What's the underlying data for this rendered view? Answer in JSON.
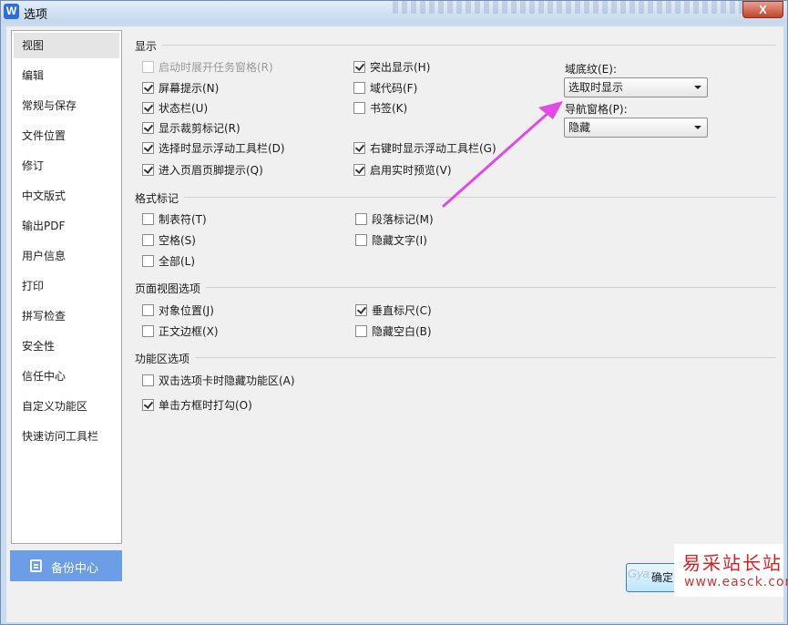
{
  "window": {
    "title": "选项",
    "app_icon_letter": "W",
    "close_label": "X"
  },
  "nav": {
    "items": [
      {
        "label": "视图",
        "active": true
      },
      {
        "label": "编辑"
      },
      {
        "label": "常规与保存"
      },
      {
        "label": "文件位置"
      },
      {
        "label": "修订"
      },
      {
        "label": "中文版式"
      },
      {
        "label": "输出PDF"
      },
      {
        "label": "用户信息"
      },
      {
        "label": "打印"
      },
      {
        "label": "拼写检查"
      },
      {
        "label": "安全性"
      },
      {
        "label": "信任中心"
      },
      {
        "label": "自定义功能区"
      },
      {
        "label": "快速访问工具栏"
      }
    ],
    "backup_label": "备份中心"
  },
  "display": {
    "title": "显示",
    "left": [
      {
        "label": "启动时展开任务窗格(R)",
        "checked": false,
        "disabled": true
      },
      {
        "label": "屏幕提示(N)",
        "checked": true
      },
      {
        "label": "状态栏(U)",
        "checked": true
      },
      {
        "label": "显示裁剪标记(R)",
        "checked": true
      },
      {
        "label": "选择时显示浮动工具栏(D)",
        "checked": true
      },
      {
        "label": "进入页眉页脚提示(Q)",
        "checked": true
      }
    ],
    "right": [
      {
        "label": "突出显示(H)",
        "checked": true
      },
      {
        "label": "域代码(F)",
        "checked": false
      },
      {
        "label": "书签(K)",
        "checked": false
      },
      {
        "label": "右键时显示浮动工具栏(G)",
        "checked": true
      },
      {
        "label": "启用实时预览(V)",
        "checked": true
      }
    ],
    "field_shading_label": "域底纹(E):",
    "field_shading_value": "选取时显示",
    "nav_pane_label": "导航窗格(P):",
    "nav_pane_value": "隐藏"
  },
  "format_marks": {
    "title": "格式标记",
    "items": [
      {
        "label": "制表符(T)",
        "checked": false
      },
      {
        "label": "段落标记(M)",
        "checked": false
      },
      {
        "label": "空格(S)",
        "checked": false
      },
      {
        "label": "隐藏文字(I)",
        "checked": false
      },
      {
        "label": "全部(L)",
        "checked": false
      }
    ]
  },
  "page_view": {
    "title": "页面视图选项",
    "items": [
      {
        "label": "对象位置(J)",
        "checked": false
      },
      {
        "label": "垂直标尺(C)",
        "checked": true
      },
      {
        "label": "正文边框(X)",
        "checked": false
      },
      {
        "label": "隐藏空白(B)",
        "checked": false
      }
    ]
  },
  "ribbon": {
    "title": "功能区选项",
    "items": [
      {
        "label": "双击选项卡时隐藏功能区(A)",
        "checked": false
      },
      {
        "label": "单击方框时打勾(O)",
        "checked": true
      }
    ]
  },
  "footer": {
    "ok_label": "确定",
    "faint_text": "Gya"
  },
  "watermark": {
    "line1": "易采站长站",
    "line2": "www.easck.com"
  },
  "colors": {
    "annotation_arrow": "#e04be8",
    "accent": "#6b9ee6"
  }
}
